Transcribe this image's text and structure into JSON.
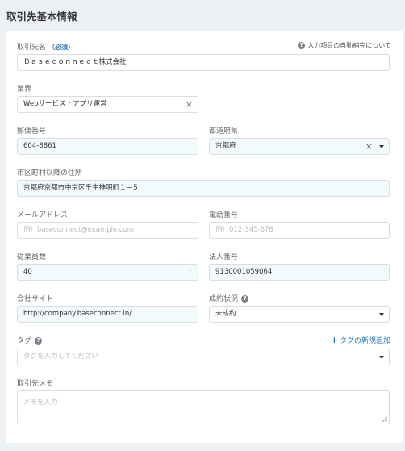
{
  "page_title": "取引先基本情報",
  "autocomplete_link": "入力項目の自動補完について",
  "company_name": {
    "label": "取引先名",
    "required": "（必須）",
    "value": "Ｂａｓｅｃｏｎｎｅｃｔ株式会社"
  },
  "industry": {
    "label": "業界",
    "value": "Webサービス・アプリ運営"
  },
  "postal_code": {
    "label": "郵便番号",
    "value": "604-8861"
  },
  "prefecture": {
    "label": "都道府県",
    "value": "京都府"
  },
  "address": {
    "label": "市区町村以降の住所",
    "value": "京都府京都市中京区壬生神明町１−５"
  },
  "email": {
    "label": "メールアドレス",
    "placeholder": "例）baseconnect@example.com"
  },
  "phone": {
    "label": "電話番号",
    "placeholder": "例）012-345-678"
  },
  "employees": {
    "label": "従業員数",
    "value": "40"
  },
  "corporate_number": {
    "label": "法人番号",
    "value": "9130001059064"
  },
  "website": {
    "label": "会社サイト",
    "value": "http://company.baseconnect.in/"
  },
  "deal_status": {
    "label": "成約状況",
    "value": "未成約"
  },
  "tags": {
    "label": "タグ",
    "placeholder": "タグを入力してください",
    "add_label": "タグの新規追加"
  },
  "memo": {
    "label": "取引先メモ",
    "placeholder": "メモを入力"
  },
  "colors": {
    "accent": "#2b7bb9",
    "filled_bg": "#f3fafe",
    "page_bg": "#eef1f4"
  },
  "icons": [
    "help-icon",
    "clear-icon",
    "chevron-down-icon",
    "plus-icon",
    "resize-handle-icon"
  ]
}
